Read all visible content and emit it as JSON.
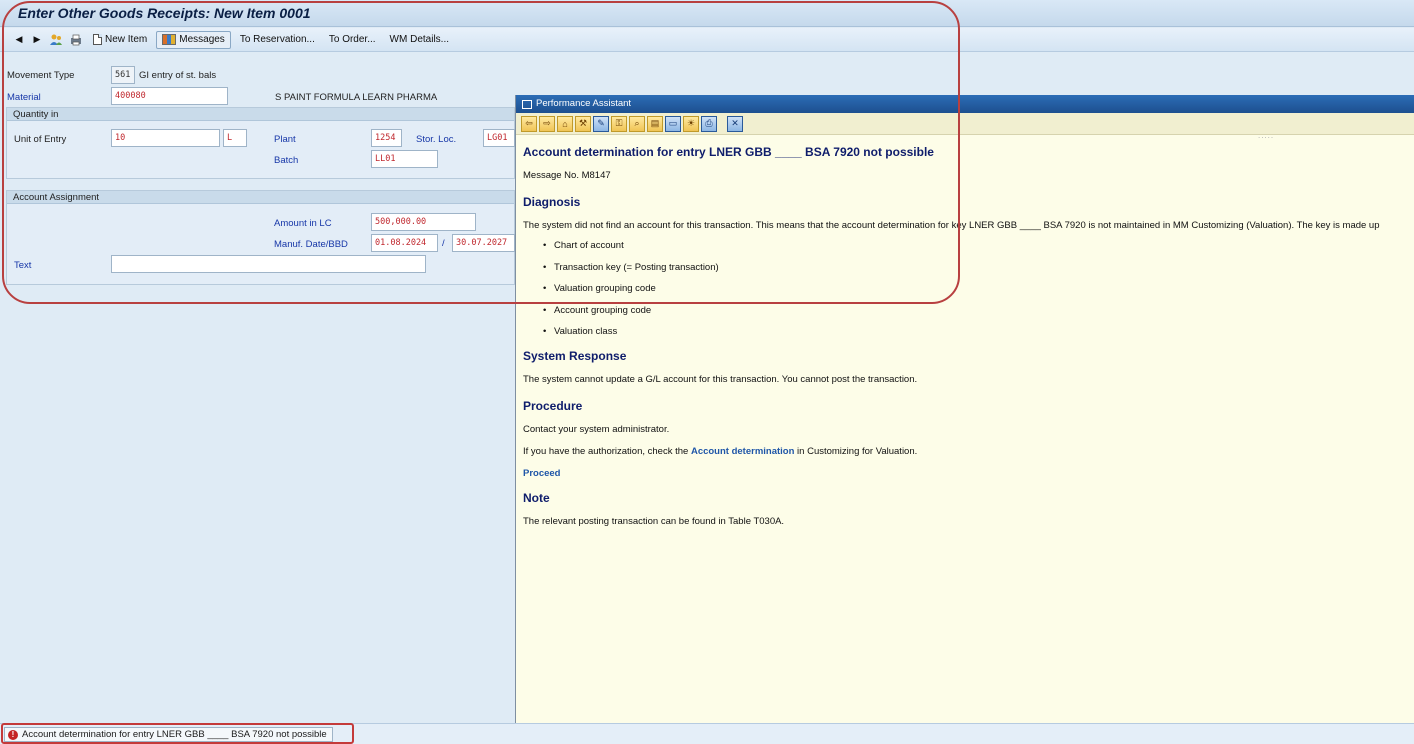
{
  "window": {
    "title": "Enter Other Goods Receipts: New Item 0001"
  },
  "toolbar": {
    "back_icon": "triangle-left-icon",
    "forward_icon": "triangle-right-icon",
    "new_item": "New Item",
    "messages": "Messages",
    "to_reservation": "To Reservation...",
    "to_order": "To Order...",
    "wm_details": "WM Details..."
  },
  "form": {
    "movement_type_label": "Movement Type",
    "movement_type_value": "561",
    "movement_type_text": "GI entry of st. bals",
    "material_label": "Material",
    "material_value": "400080",
    "material_desc": "S PAINT FORMULA LEARN PHARMA",
    "quantity_group": "Quantity in",
    "unit_of_entry_label": "Unit of Entry",
    "unit_of_entry_value": "10",
    "unit_value": "L",
    "plant_label": "Plant",
    "plant_value": "1254",
    "stor_loc_label": "Stor. Loc.",
    "stor_loc_value": "LG01",
    "batch_label": "Batch",
    "batch_value": "LL01",
    "account_group": "Account Assignment",
    "amount_label": "Amount in LC",
    "amount_value": "500,000.00",
    "manuf_label": "Manuf. Date/BBD",
    "manuf_date": "01.08.2024",
    "separator": "/",
    "bbd_date": "30.07.2027",
    "text_label": "Text",
    "text_value": ""
  },
  "assistant": {
    "title": "Performance Assistant",
    "heading": "Account determination for entry LNER GBB ____ BSA 7920 not possible",
    "message_no": "Message No. M8147",
    "diagnosis_title": "Diagnosis",
    "diagnosis_text": "The system did not find an account for this transaction. This means that the account determination for key LNER GBB ____ BSA 7920 is not maintained in MM Customizing (Valuation). The key is made up",
    "key_items": [
      "Chart of account",
      "Transaction key (= Posting transaction)",
      "Valuation grouping code",
      "Account grouping code",
      "Valuation class"
    ],
    "response_title": "System Response",
    "response_text": "The system cannot update a G/L account for this transaction. You cannot post the transaction.",
    "procedure_title": "Procedure",
    "procedure_text1": "Contact your system administrator.",
    "procedure_text2_pre": "If you have the authorization, check the ",
    "procedure_link": "Account determination",
    "procedure_text2_post": " in Customizing for Valuation.",
    "proceed_link": "Proceed",
    "note_title": "Note",
    "note_text": "The relevant posting transaction can be found in Table T030A.",
    "dots": "....."
  },
  "status": {
    "message": "Account determination for entry LNER GBB ____ BSA 7920 not possible",
    "icon": "error-icon"
  },
  "colors": {
    "annotation": "#b84040",
    "pa_heading": "#0f1d6b",
    "field_value": "#c0282e"
  }
}
